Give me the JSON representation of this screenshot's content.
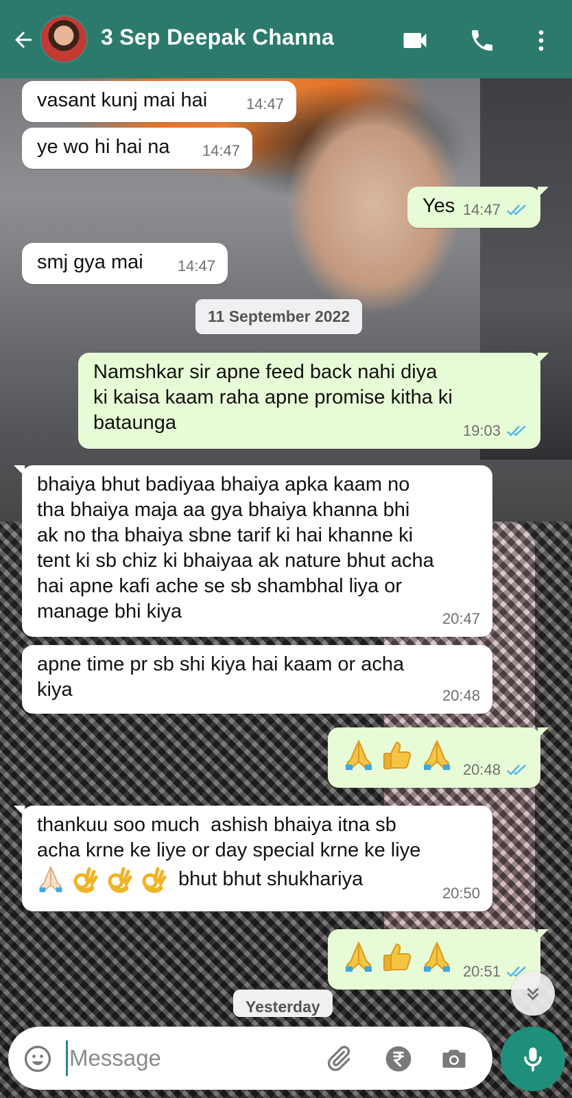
{
  "header": {
    "contact_name": "3 Sep Deepak Channa",
    "back_icon": "arrow-left-icon",
    "video_icon": "video-camera-icon",
    "call_icon": "phone-icon",
    "menu_icon": "more-vertical-icon",
    "color": "#2b7a6b"
  },
  "messages": [
    {
      "dir": "in",
      "text": "vasant kunj mai hai",
      "time": "14:47"
    },
    {
      "dir": "in",
      "text": "ye wo hi hai na",
      "time": "14:47"
    },
    {
      "dir": "out",
      "text": "Yes",
      "time": "14:47",
      "status": "read"
    },
    {
      "dir": "in",
      "text": "smj gya mai",
      "time": "14:47"
    },
    {
      "dir": "out",
      "text": "Namshkar sir apne feed back nahi diya\nki kaisa kaam raha apne promise kitha ki\nbataunga",
      "time": "19:03",
      "status": "read"
    },
    {
      "dir": "in",
      "text": "bhaiya bhut badiyaa bhaiya apka kaam no\ntha bhaiya maja aa gya bhaiya khanna bhi\nak no tha bhaiya sbne tarif ki hai khanne ki\ntent ki sb chiz ki bhaiyaa ak nature bhut acha\nhai apne kafi ache se sb shambhal liya or\nmanage bhi kiya",
      "time": "20:47"
    },
    {
      "dir": "in",
      "text": "apne time pr sb shi kiya hai kaam or acha\nkiya",
      "time": "20:48"
    },
    {
      "dir": "out",
      "emojis": [
        "folded-hands",
        "thumbs-up",
        "folded-hands"
      ],
      "time": "20:48",
      "status": "read"
    },
    {
      "dir": "in",
      "text": "thankuu soo much  ashish bhaiya itna sb\nacha krne ke liye or day special krne ke liye",
      "text2": "bhut bhut shukhariya",
      "emojis": [
        "folded-hands",
        "ok-hand",
        "ok-hand",
        "ok-hand"
      ],
      "time": "20:50"
    },
    {
      "dir": "out",
      "emojis": [
        "folded-hands",
        "thumbs-up",
        "folded-hands"
      ],
      "time": "20:51",
      "status": "read"
    }
  ],
  "date_separators": {
    "first": "11 September 2022",
    "partial": "Yesterday"
  },
  "input": {
    "placeholder": "Message",
    "emoji_icon": "smiley-icon",
    "attach_icon": "paperclip-icon",
    "payment_icon": "rupee-icon",
    "camera_icon": "camera-icon",
    "mic_icon": "microphone-icon"
  },
  "colors": {
    "outgoing_bubble": "#e7fbd6",
    "incoming_bubble": "#ffffff",
    "accent": "#1f8f7c",
    "read_ticks": "#4fb6ec"
  }
}
